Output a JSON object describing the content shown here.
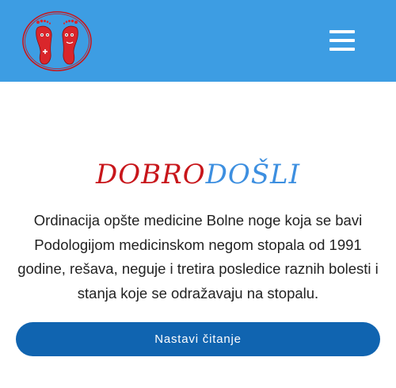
{
  "header": {
    "logo_name": "feet-logo",
    "menu_icon": "hamburger-menu-icon",
    "background_color": "#3d9de3"
  },
  "welcome": {
    "part_red": "DOBRO",
    "part_blue": "DOŠLI",
    "red_color": "#c8161b",
    "blue_color": "#3d8fe0"
  },
  "intro": {
    "text": "Ordinacija opšte medicine Bolne noge koja se bavi Podologijom medicinskom negom stopala od 1991 godine, rešava, neguje i tretira posledice raznih bolesti i stanja koje se odražavaju na stopalu."
  },
  "read_more": {
    "label": "Nastavi čitanje",
    "color": "#1064b0"
  }
}
